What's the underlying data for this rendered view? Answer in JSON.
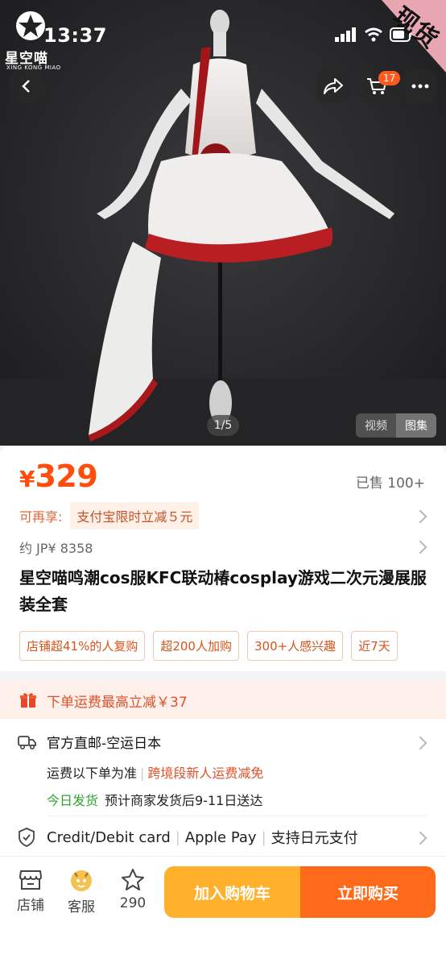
{
  "status_bar": {
    "time": "13:37"
  },
  "brand": {
    "name": "星空喵",
    "sub": "XING KONG MIAO"
  },
  "corner_label": "现货",
  "header": {
    "cart_count": "17"
  },
  "gallery": {
    "counter": "1/5",
    "tabs": [
      "视频",
      "图集"
    ],
    "active_tab": "图集"
  },
  "price": {
    "currency": "¥",
    "value": "329",
    "sold": "已售 100+"
  },
  "promo": {
    "label": "可再享:",
    "chip": "支付宝限时立减５元"
  },
  "jp_price": "约 JP¥ 8358",
  "title": "星空喵鸣潮cos服KFC联动椿cosplay游戏二次元漫展服装全套",
  "tags": [
    "店铺超41%的人复购",
    "超200人加购",
    "300+人感兴趣",
    "近7天"
  ],
  "discount": {
    "text": "下单运费最高立减￥37"
  },
  "shipping": {
    "method": "官方直邮-空运日本",
    "fee_note": "运费以下单为准",
    "fee_promo": "跨境段新人运费减免",
    "ship_today": "今日发货",
    "eta": "预计商家发货后9-11日送达"
  },
  "payment": {
    "methods": [
      "Credit/Debit card",
      "Apple Pay",
      "支持日元支付"
    ]
  },
  "bottom_bar": {
    "store": "店铺",
    "service": "客服",
    "favorites": "290",
    "add_to_cart": "加入购物车",
    "buy_now": "立即购买"
  },
  "colors": {
    "accent": "#ff4d0c",
    "cart_button": "#ffb12b",
    "buy_button": "#ff6a1a",
    "corner": "#e8a6b2"
  }
}
